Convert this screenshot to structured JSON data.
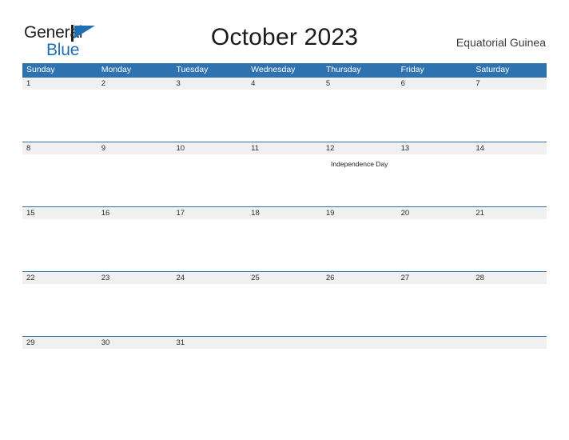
{
  "brand": {
    "name_part1": "General",
    "name_part2": "Blue",
    "flag_icon": "flag-icon",
    "color_dark": "#231f20",
    "color_blue": "#1f6fb5"
  },
  "header": {
    "title": "October 2023",
    "subtitle": "Equatorial Guinea"
  },
  "calendar": {
    "accent_color": "#2f72b0",
    "band_color": "#f0f0f0",
    "weekdays": [
      "Sunday",
      "Monday",
      "Tuesday",
      "Wednesday",
      "Thursday",
      "Friday",
      "Saturday"
    ],
    "weeks": [
      {
        "days": [
          {
            "num": "1",
            "event": ""
          },
          {
            "num": "2",
            "event": ""
          },
          {
            "num": "3",
            "event": ""
          },
          {
            "num": "4",
            "event": ""
          },
          {
            "num": "5",
            "event": ""
          },
          {
            "num": "6",
            "event": ""
          },
          {
            "num": "7",
            "event": ""
          }
        ]
      },
      {
        "days": [
          {
            "num": "8",
            "event": ""
          },
          {
            "num": "9",
            "event": ""
          },
          {
            "num": "10",
            "event": ""
          },
          {
            "num": "11",
            "event": ""
          },
          {
            "num": "12",
            "event": "Independence Day"
          },
          {
            "num": "13",
            "event": ""
          },
          {
            "num": "14",
            "event": ""
          }
        ]
      },
      {
        "days": [
          {
            "num": "15",
            "event": ""
          },
          {
            "num": "16",
            "event": ""
          },
          {
            "num": "17",
            "event": ""
          },
          {
            "num": "18",
            "event": ""
          },
          {
            "num": "19",
            "event": ""
          },
          {
            "num": "20",
            "event": ""
          },
          {
            "num": "21",
            "event": ""
          }
        ]
      },
      {
        "days": [
          {
            "num": "22",
            "event": ""
          },
          {
            "num": "23",
            "event": ""
          },
          {
            "num": "24",
            "event": ""
          },
          {
            "num": "25",
            "event": ""
          },
          {
            "num": "26",
            "event": ""
          },
          {
            "num": "27",
            "event": ""
          },
          {
            "num": "28",
            "event": ""
          }
        ]
      },
      {
        "days": [
          {
            "num": "29",
            "event": ""
          },
          {
            "num": "30",
            "event": ""
          },
          {
            "num": "31",
            "event": ""
          },
          {
            "num": "",
            "event": ""
          },
          {
            "num": "",
            "event": ""
          },
          {
            "num": "",
            "event": ""
          },
          {
            "num": "",
            "event": ""
          }
        ]
      }
    ]
  }
}
